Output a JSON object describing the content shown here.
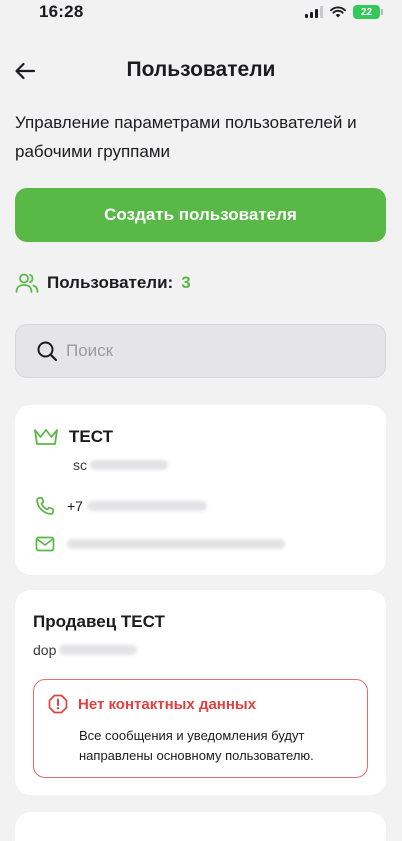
{
  "status_bar": {
    "time": "16:28",
    "battery": "22"
  },
  "header": {
    "title": "Пользователи"
  },
  "subtitle": "Управление параметрами пользователей и рабочими группами",
  "create_button": "Создать пользователя",
  "users": {
    "label": "Пользователи:",
    "count": "3"
  },
  "search": {
    "placeholder": "Поиск"
  },
  "cards": [
    {
      "name": "ТЕСТ",
      "login_prefix": "sc",
      "phone_prefix": "+7"
    },
    {
      "name": "Продавец ТЕСТ",
      "login_prefix": "dop",
      "alert": {
        "title": "Нет контактных данных",
        "text": "Все сообщения и уведомления будут направлены основному пользователю."
      }
    }
  ],
  "colors": {
    "accent": "#59b946",
    "error": "#e0403f",
    "background": "#f2f2f3"
  },
  "icons": [
    "back-arrow-icon",
    "users-icon",
    "search-icon",
    "crown-icon",
    "phone-icon",
    "mail-icon",
    "alert-icon"
  ]
}
